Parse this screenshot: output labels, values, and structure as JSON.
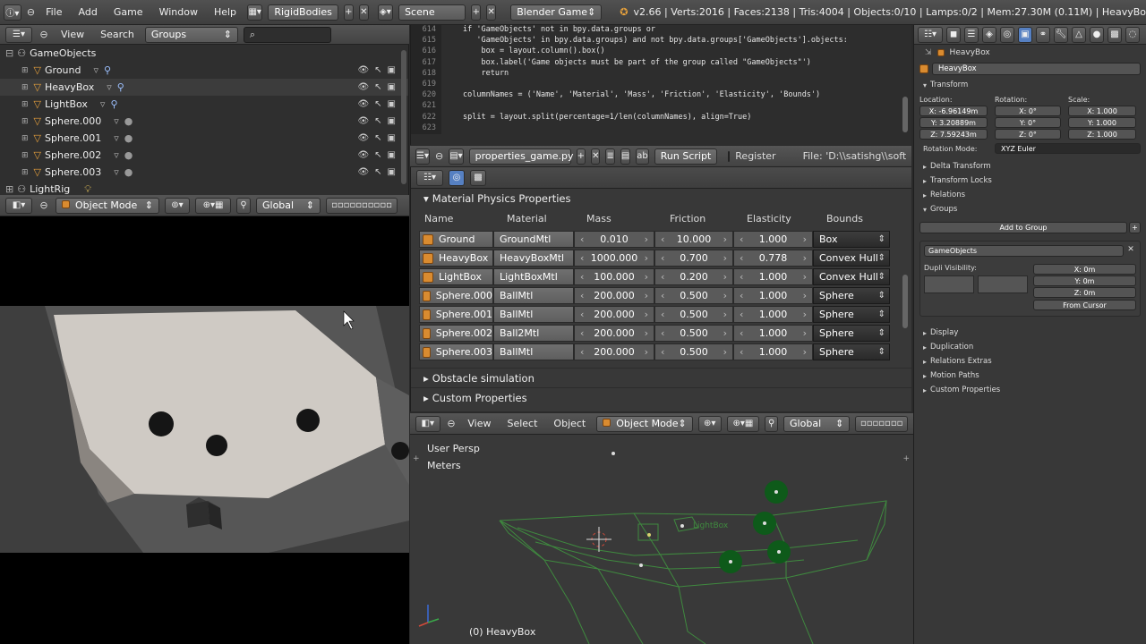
{
  "topbar": {
    "menus": [
      "File",
      "Add",
      "Game",
      "Window",
      "Help"
    ],
    "screen_layout": "RigidBodies",
    "scene": "Scene",
    "engine": "Blender Game",
    "stats": "v2.66 | Verts:2016 | Faces:2138 | Tris:4004 | Objects:0/10 | Lamps:0/2 | Mem:27.30M (0.11M) | HeavyBo"
  },
  "outliner": {
    "menus": [
      "View",
      "Search"
    ],
    "display_mode": "Groups",
    "group_name": "GameObjects",
    "items": [
      {
        "name": "Ground"
      },
      {
        "name": "HeavyBox"
      },
      {
        "name": "LightBox"
      },
      {
        "name": "Sphere.000"
      },
      {
        "name": "Sphere.001"
      },
      {
        "name": "Sphere.002"
      },
      {
        "name": "Sphere.003"
      }
    ],
    "next_group": "LightRig"
  },
  "viewport_left": {
    "mode": "Object Mode",
    "orientation": "Global"
  },
  "text_editor": {
    "lines": [
      {
        "num": "614",
        "text": "if 'GameObjects' not in bpy.data.groups or"
      },
      {
        "num": "615",
        "text": "   'GameObjects' in bpy.data.groups) and not bpy.data.groups['GameObjects'].objects:"
      },
      {
        "num": "616",
        "text": "    box = layout.column().box()"
      },
      {
        "num": "617",
        "text": "    box.label('Game objects must be part of the group called \"GameObjects\"')"
      },
      {
        "num": "618",
        "text": "    return"
      },
      {
        "num": "619",
        "text": ""
      },
      {
        "num": "620",
        "text": "columnNames = ('Name', 'Material', 'Mass', 'Friction', 'Elasticity', 'Bounds')"
      },
      {
        "num": "621",
        "text": ""
      },
      {
        "num": "622",
        "text": "split = layout.split(percentage=1/len(columnNames), align=True)"
      },
      {
        "num": "623",
        "text": ""
      }
    ],
    "filename": "properties_game.py",
    "run_label": "Run Script",
    "register_label": "Register",
    "file_path": "File: 'D:\\\\satishg\\\\soft"
  },
  "material_panel": {
    "title": "Material Physics Properties",
    "columns": [
      "Name",
      "Material",
      "Mass",
      "Friction",
      "Elasticity",
      "Bounds"
    ],
    "rows": [
      {
        "name": "Ground",
        "material": "GroundMtl",
        "mass": "0.010",
        "friction": "10.000",
        "elasticity": "1.000",
        "bounds": "Box"
      },
      {
        "name": "HeavyBox",
        "material": "HeavyBoxMtl",
        "mass": "1000.000",
        "friction": "0.700",
        "elasticity": "0.778",
        "bounds": "Convex Hull"
      },
      {
        "name": "LightBox",
        "material": "LightBoxMtl",
        "mass": "100.000",
        "friction": "0.200",
        "elasticity": "1.000",
        "bounds": "Convex Hull"
      },
      {
        "name": "Sphere.000",
        "material": "BallMtl",
        "mass": "200.000",
        "friction": "0.500",
        "elasticity": "1.000",
        "bounds": "Sphere"
      },
      {
        "name": "Sphere.001",
        "material": "BallMtl",
        "mass": "200.000",
        "friction": "0.500",
        "elasticity": "1.000",
        "bounds": "Sphere"
      },
      {
        "name": "Sphere.002",
        "material": "Ball2Mtl",
        "mass": "200.000",
        "friction": "0.500",
        "elasticity": "1.000",
        "bounds": "Sphere"
      },
      {
        "name": "Sphere.003",
        "material": "BallMtl",
        "mass": "200.000",
        "friction": "0.500",
        "elasticity": "1.000",
        "bounds": "Sphere"
      }
    ],
    "collapsed_panels": [
      "Obstacle simulation",
      "Custom Properties"
    ]
  },
  "viewport_right": {
    "menus": [
      "View",
      "Select",
      "Object"
    ],
    "mode": "Object Mode",
    "orientation": "Global",
    "overlay_view": "User Persp",
    "overlay_units": "Meters",
    "overlay_object": "(0) HeavyBox",
    "wire_label": "LightBox"
  },
  "properties": {
    "breadcrumb": "HeavyBox",
    "object_name": "HeavyBox",
    "transform_title": "Transform",
    "location_label": "Location:",
    "rotation_label": "Rotation:",
    "scale_label": "Scale:",
    "location": [
      "X: -6.96149m",
      "Y: 3.20889m",
      "Z: 7.59243m"
    ],
    "rotation": [
      "X: 0°",
      "Y: 0°",
      "Z: 0°"
    ],
    "scale": [
      "X: 1.000",
      "Y: 1.000",
      "Z: 1.000"
    ],
    "rotation_mode_label": "Rotation Mode:",
    "rotation_mode": "XYZ Euler",
    "sections_a": [
      "Delta Transform",
      "Transform Locks",
      "Relations"
    ],
    "groups_title": "Groups",
    "add_to_group": "Add to Group",
    "group_field": "GameObjects",
    "dupli_label": "Dupli Visibility:",
    "dupli_offset": [
      "X: 0m",
      "Y: 0m",
      "Z: 0m"
    ],
    "from_cursor": "From Cursor",
    "sections_b": [
      "Display",
      "Duplication",
      "Relations Extras",
      "Motion Paths",
      "Custom Properties"
    ]
  },
  "colors": {
    "accent_blue": "#5680c2",
    "object_orange": "#d98b30",
    "wire_green": "#3f8a3f"
  }
}
